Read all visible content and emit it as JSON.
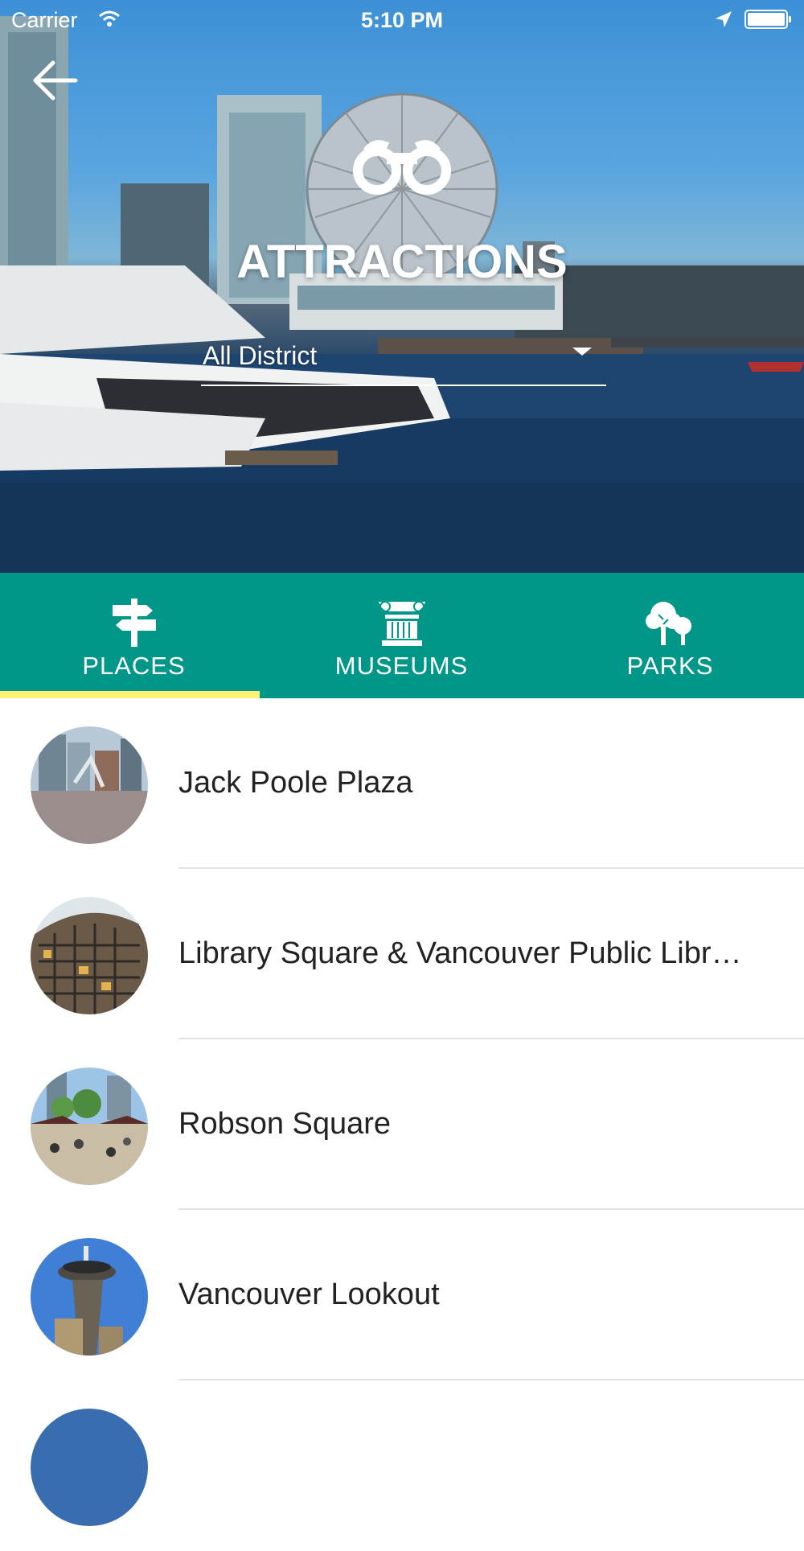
{
  "status_bar": {
    "carrier": "Carrier",
    "time": "5:10 PM"
  },
  "header": {
    "title": "ATTRACTIONS",
    "icon": "binoculars-icon",
    "back_icon": "back-arrow-icon"
  },
  "district_filter": {
    "selected": "All District"
  },
  "tabs": [
    {
      "label": "PLACES",
      "icon": "signpost-icon",
      "active": true
    },
    {
      "label": "MUSEUMS",
      "icon": "column-icon",
      "active": false
    },
    {
      "label": "PARKS",
      "icon": "trees-icon",
      "active": false
    }
  ],
  "places": [
    {
      "name": "Jack Poole Plaza"
    },
    {
      "name": "Library Square & Vancouver Public Libr…"
    },
    {
      "name": "Robson Square"
    },
    {
      "name": "Vancouver Lookout"
    }
  ],
  "colors": {
    "tab_bar": "#009688",
    "active_indicator": "#fff176",
    "divider": "#e3e3e3"
  }
}
